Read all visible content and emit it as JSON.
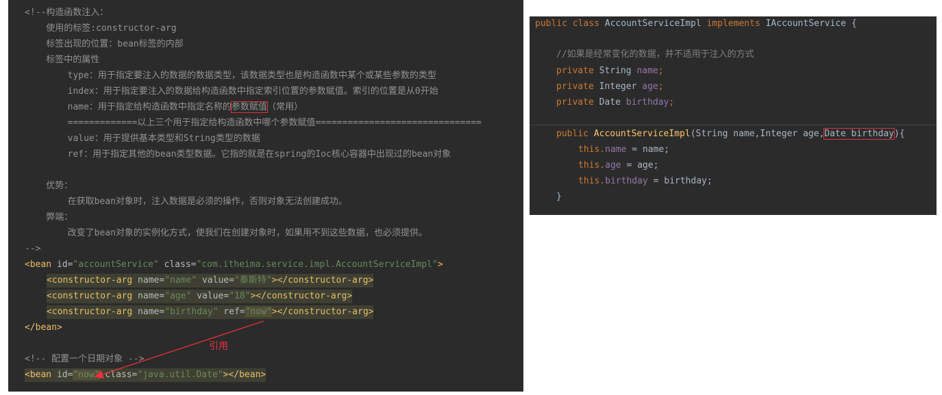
{
  "left": {
    "lines": [
      "<!--构造函数注入：",
      "    使用的标签:constructor-arg",
      "    标签出现的位置：bean标签的内部",
      "    标签中的属性",
      "        type：用于指定要注入的数据的数据类型，该数据类型也是构造函数中某个或某些参数的类型",
      "        index：用于指定要注入的数据给构造函数中指定索引位置的参数赋值。索引的位置是从0开始",
      "        name：用于指定给构造函数中指定名称的",
      "参数赋值",
      "（常用）",
      "        =============以上三个用于指定给构造函数中哪个参数赋值===============================",
      "        value：用于提供基本类型和String类型的数据",
      "        ref：用于指定其他的bean类型数据。它指的就是在spring的Ioc核心容器中出现过的bean对象",
      "    优势：",
      "        在获取bean对象时，注入数据是必须的操作，否则对象无法创建成功。",
      "    弊端：",
      "        改变了bean对象的实例化方式，使我们在创建对象时，如果用不到这些数据，也必须提供。",
      "-->"
    ],
    "bean": {
      "open": "<bean",
      "id_attr": " id=",
      "id_val": "\"accountService\"",
      "class_attr": " class=",
      "class_val": "\"com.itheima.service.impl.AccountServiceImpl\"",
      "close": ">",
      "end": "</bean>"
    },
    "args": [
      {
        "open": "<constructor-arg",
        "name_attr": " name=",
        "name_val": "\"name\"",
        "v_attr": " value=",
        "v_val": "\"泰斯特\"",
        "close": "></constructor-arg>"
      },
      {
        "open": "<constructor-arg",
        "name_attr": " name=",
        "name_val": "\"age\"",
        "v_attr": " value=",
        "v_val": "\"18\"",
        "close": "></constructor-arg>"
      },
      {
        "open": "<constructor-arg",
        "name_attr": " name=",
        "name_val": "\"birthday\"",
        "v_attr": " ref=",
        "v_val": "\"now\"",
        "close": "></constructor-arg>"
      }
    ],
    "date_comment": "<!-- 配置一个日期对象 -->",
    "date_bean": {
      "open": "<bean",
      "id_attr": " id=",
      "id_val": "\"now\"",
      "class_attr": " class=",
      "class_val": "\"java.util.Date\"",
      "close": "></bean>"
    },
    "annotation": "引用"
  },
  "right": {
    "decl": {
      "k1": "public",
      "k2": " class",
      "name": " AccountServiceImpl",
      "k3": " implements",
      "iface": " IAccountService",
      "brace": " {"
    },
    "comment": "//如果是经常变化的数据，并不适用于注入的方式",
    "fields": [
      {
        "k": "private",
        "type": " String",
        "name": " name",
        "semi": ";"
      },
      {
        "k": "private",
        "type": " Integer",
        "name": " age",
        "semi": ";"
      },
      {
        "k": "private",
        "type": " Date",
        "name": " birthday",
        "semi": ";"
      }
    ],
    "ctor": {
      "k": "public",
      "name": " AccountServiceImpl",
      "params": "(String name,Integer age,",
      "boxed": "Date birthday",
      "end": "){"
    },
    "assigns": [
      {
        "this": "this.",
        "field": "name",
        "rest": " = name;"
      },
      {
        "this": "this.",
        "field": "age",
        "rest": " = age;"
      },
      {
        "this": "this.",
        "field": "birthday",
        "rest": " = birthday;"
      }
    ],
    "close": "}",
    "colors": {
      "keyword": "#cc7832",
      "field": "#9876aa",
      "method": "#ffc66d",
      "tag": "#e8bf6a",
      "value": "#6a8759"
    }
  }
}
